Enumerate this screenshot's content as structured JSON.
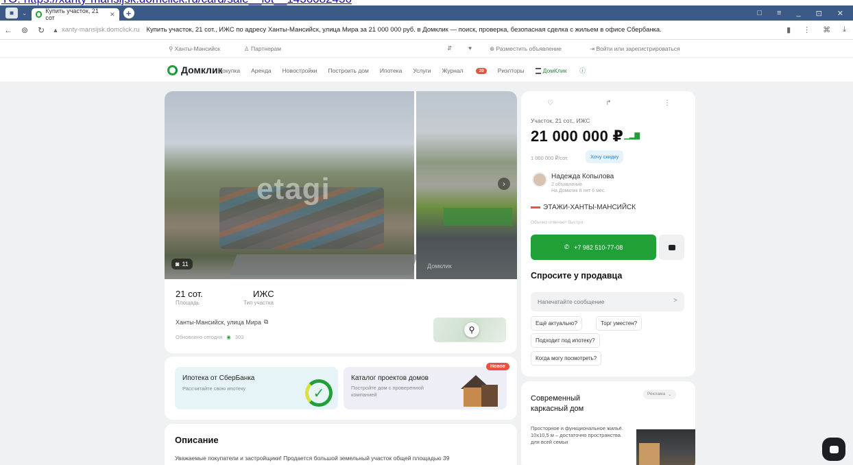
{
  "overlay_url": "TO: https://xanty-mansijsk.domclick.ru/card/sale__lot__1436082436",
  "browser": {
    "tab_title": "Купить участок, 21 сот",
    "new_tab": "+",
    "address_domain": "xanty-mansijsk.domclick.ru",
    "address_title": "Купить участок, 21 сот., ИЖС по адресу Ханты-Мансийск, улица Мира за 21 000 000 руб. в Домклик — поиск, проверка, безопасная сделка с жильем в офисе Сбербанка.",
    "controls": [
      "□",
      "≡",
      "_",
      "⊡",
      "✕"
    ]
  },
  "site_top": {
    "location": "Ханты-Мансийск",
    "partners": "Партнерам",
    "post_ad": "Разместить объявление",
    "login": "Войти или зарегистрироваться"
  },
  "nav": {
    "logo": "Домклик",
    "items": [
      "Покупка",
      "Аренда",
      "Новостройки",
      "Построить дом",
      "Ипотека",
      "Услуги",
      "Журнал",
      "Риэлторы"
    ],
    "journal_badge": "20",
    "domclick_pro": "ДомКлик"
  },
  "listing": {
    "photo_watermark": "etagi",
    "photo_count": "11",
    "small_watermark": "Домклик",
    "area_value": "21 сот.",
    "area_label": "Площадь",
    "type_value": "ИЖС",
    "type_label": "Тип участка",
    "address": "Ханты-Мансийск, улица Мира",
    "updated": "Обновлено сегодня",
    "views": "303"
  },
  "promos": [
    {
      "title": "Ипотека от СберБанка",
      "subtitle": "Рассчитайте свою ипотеку"
    },
    {
      "title": "Каталог проектов домов",
      "subtitle": "Постройте дом с проверенной компанией",
      "badge": "Новое"
    }
  ],
  "description": {
    "heading": "Описание",
    "text": "Уважаемые покупатели и застройщики! Продается большой земельный участок общей площадью 39"
  },
  "sidebar": {
    "kind": "Участок, 21 сот., ИЖС",
    "price": "21 000 000 ₽",
    "price_per_unit": "1 000 000 ₽/сот.",
    "discount_btn": "Хочу скидку",
    "agent_name": "Надежда Копылова",
    "agent_ads": "2 объявления",
    "agent_since": "На Домклик 8 лет 6 мес.",
    "agency": "ЭТАЖИ-ХАНТЫ-МАНСИЙСК",
    "reply_note": "Обычно отвечает быстро",
    "phone": "+7 982 510-77-08",
    "ask_heading": "Спросите у продавца",
    "ask_placeholder": "Напечатайте сообщение",
    "chips": [
      "Ещё актуально?",
      "Торг уместен?",
      "Подходит под ипотеку?",
      "Когда могу посмотреть?"
    ]
  },
  "ad": {
    "tag": "Реклама",
    "title": "Современный каркасный дом",
    "text": "Просторное и функциональное жильё. 10х10,5 м – достаточно пространства для всей семьи"
  }
}
